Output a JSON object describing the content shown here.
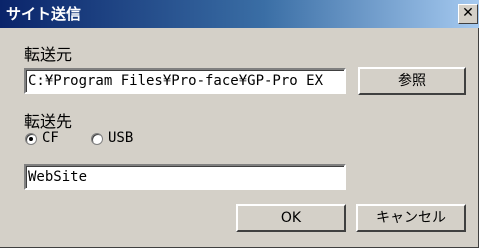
{
  "window": {
    "title": "サイト送信",
    "close_glyph": "✕"
  },
  "source": {
    "label": "転送元",
    "path_value": "C:¥Program Files¥Pro-face¥GP-Pro EX",
    "browse_label": "参照"
  },
  "destination": {
    "label": "転送先",
    "options": [
      {
        "label": "CF",
        "selected": true
      },
      {
        "label": "USB",
        "selected": false
      }
    ],
    "name_value": "WebSite"
  },
  "buttons": {
    "ok_label": "OK",
    "cancel_label": "キャンセル"
  }
}
